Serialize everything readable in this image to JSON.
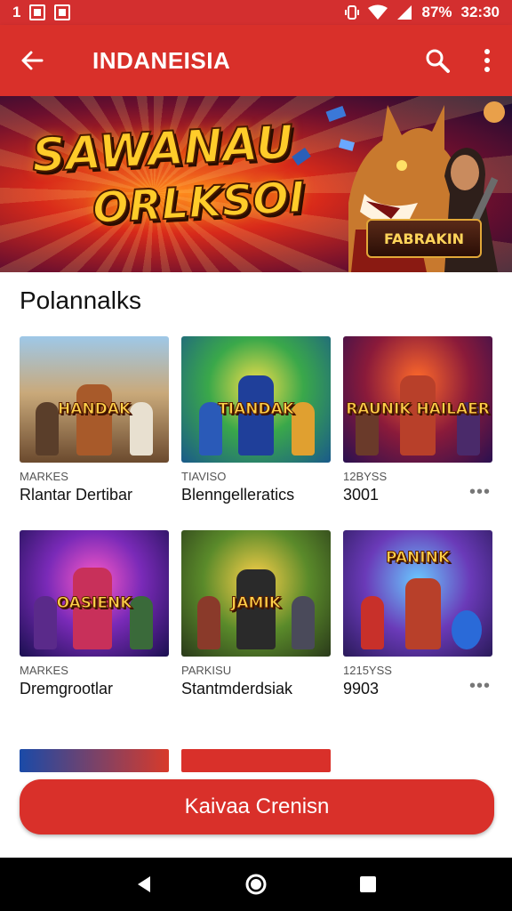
{
  "status_bar": {
    "left_number": "1",
    "battery": "87%",
    "time": "32:30"
  },
  "app_bar": {
    "title": "INDANEISIA"
  },
  "hero": {
    "title_line1": "SAWANAU",
    "title_line2": "ORLKSOI",
    "badge": "FABRAKIN"
  },
  "section": {
    "title": "Polannalks"
  },
  "cards": [
    {
      "logo": "HANDAK",
      "meta": "MARKES",
      "name": "Rlantar Dertibar",
      "more": false
    },
    {
      "logo": "TIANDAK",
      "meta": "TIAVISO",
      "name": "Blenngelleratics",
      "more": false
    },
    {
      "logo": "RAUNIK HAILAER",
      "meta": "12BYSS",
      "name": "3001",
      "more": true
    },
    {
      "logo": "OASIENK",
      "meta": "MARKES",
      "name": "Dremgrootlar",
      "more": false
    },
    {
      "logo": "JAMIK",
      "meta": "PARKISU",
      "name": "Stantmderdsiak",
      "more": false
    },
    {
      "logo": "PANINK",
      "meta": "1215YSS",
      "name": "9903",
      "more": true
    }
  ],
  "cta": {
    "label": "Kaivaa Crenisn"
  },
  "colors": {
    "accent": "#d9302a",
    "status": "#d32f2f"
  }
}
